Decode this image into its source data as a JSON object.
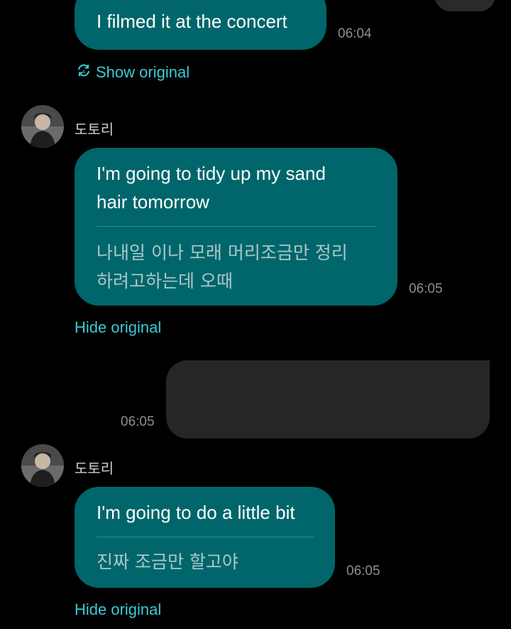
{
  "colors": {
    "background": "#000000",
    "incoming_bubble": "#00666b",
    "outgoing_bubble": "#262626",
    "link": "#3ec9d6",
    "timestamp": "#8e8e8e"
  },
  "messages": [
    {
      "type": "incoming",
      "text": "I filmed it at the concert",
      "time": "06:04",
      "toggle_label": "Show original",
      "toggle_icon": "translate-refresh-icon"
    },
    {
      "type": "incoming",
      "sender": "도토리",
      "text_lines": [
        "I'm going to tidy up my sand",
        "hair tomorrow"
      ],
      "original_lines": [
        "나내일 이나 모래 머리조금만 정리",
        "하려고하는데 오때"
      ],
      "time": "06:05",
      "toggle_label": "Hide original"
    },
    {
      "type": "outgoing",
      "time": "06:05"
    },
    {
      "type": "incoming",
      "sender": "도토리",
      "text": "I'm going to do a little bit",
      "original": "진짜 조금만 할고야",
      "time": "06:05",
      "toggle_label": "Hide original"
    }
  ]
}
